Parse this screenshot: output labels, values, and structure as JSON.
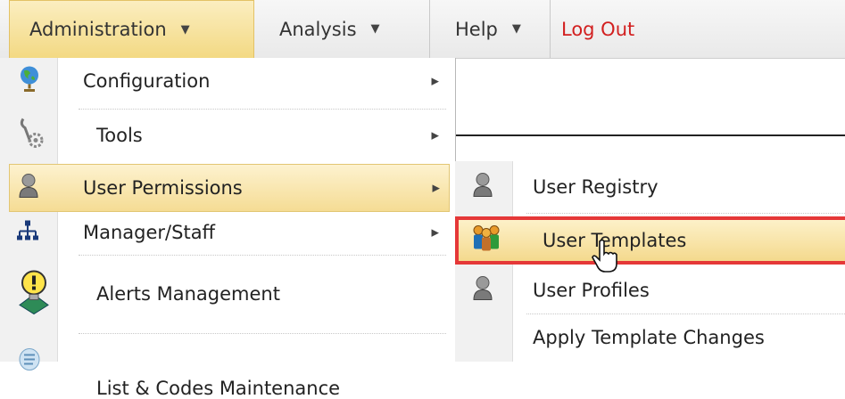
{
  "menubar": {
    "items": [
      {
        "label": "Administration",
        "has_arrow": true,
        "active": true
      },
      {
        "label": "Analysis",
        "has_arrow": true
      },
      {
        "label": "Help",
        "has_arrow": true
      },
      {
        "label": "Log Out",
        "has_arrow": false
      }
    ],
    "arrow_glyph": "▼"
  },
  "admin_menu": {
    "items": [
      {
        "label": "Configuration",
        "icon": "globe-icon",
        "has_submenu": true
      },
      {
        "label": "Tools",
        "icon": "tools-gear-icon",
        "has_submenu": true
      },
      {
        "label": "User Permissions",
        "icon": "user-icon",
        "has_submenu": true,
        "highlighted": true
      },
      {
        "label": "Manager/Staff",
        "icon": "org-chart-icon",
        "has_submenu": true
      },
      {
        "label": "Alerts Management",
        "icon": "alert-bulb-icon",
        "has_submenu": false
      },
      {
        "label": "List & Codes Maintenance",
        "icon": "list-icon",
        "has_submenu": false
      }
    ],
    "submenu_glyph": "▶"
  },
  "user_permissions_menu": {
    "items": [
      {
        "label": "User Registry",
        "icon": "user-icon"
      },
      {
        "label": "User Templates",
        "icon": "user-group-icon",
        "selected": true
      },
      {
        "label": "User Profiles",
        "icon": "user-icon"
      },
      {
        "label": "Apply Template Changes",
        "icon": ""
      }
    ]
  },
  "colors": {
    "highlight": "#f5dc94",
    "selection_border": "#e53838",
    "logout": "#d21f1f"
  }
}
